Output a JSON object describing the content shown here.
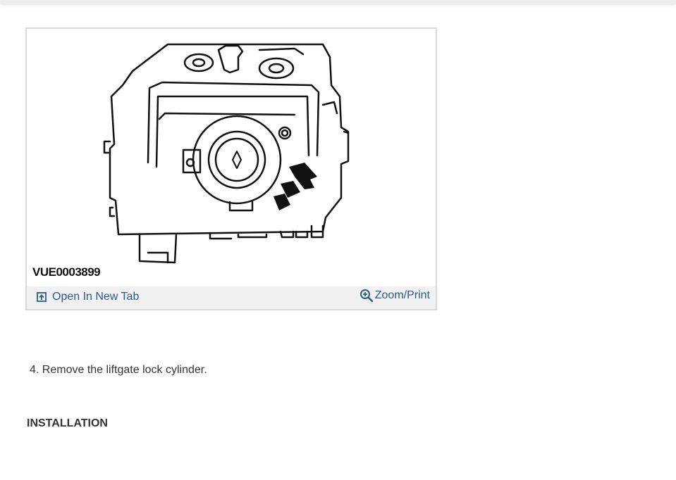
{
  "figure": {
    "code": "VUE0003899",
    "open_tab_label": "Open In New Tab",
    "zoom_print_label": "Zoom/Print"
  },
  "content": {
    "step_4": "4. Remove the liftgate lock cylinder.",
    "installation_heading": "INSTALLATION"
  },
  "icons": {
    "open_tab": "open-in-new-tab-icon",
    "zoom": "zoom-in-icon"
  },
  "colors": {
    "link": "#2a5d8c",
    "figure_bar": "#f1f1f1",
    "figure_border": "#d9d9d9"
  }
}
